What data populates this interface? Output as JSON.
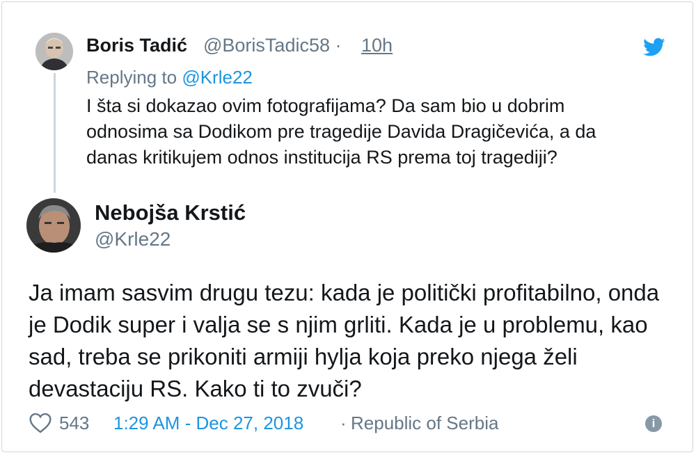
{
  "parent_tweet": {
    "name": "Boris Tadić",
    "handle": "@BorisTadic58",
    "separator": "·",
    "time": "10h",
    "replying_prefix": "Replying to",
    "replying_to": "@Krle22",
    "text": "I šta si dokazao ovim fotografijama? Da sam bio u dobrim odnosima sa Dodikom pre tragedije Davida Dragičevića, a da danas kritikujem odnos institucija RS prema toj tragediji?"
  },
  "main_tweet": {
    "name": "Nebojša Krstić",
    "handle": "@Krle22",
    "text": "Ja imam sasvim drugu tezu: kada je politički profitabilno, onda je Dodik super i valja se s njim grliti. Kada je u problemu, kao sad, treba se prikoniti armiji hylja koja preko njega želi devastaciju RS. Kako ti to zvuči?"
  },
  "footer": {
    "likes": "543",
    "timestamp": "1:29 AM - Dec 27, 2018",
    "separator": "·",
    "location": "Republic of Serbia",
    "info_glyph": "i"
  },
  "icons": {
    "logo": "twitter-bird-icon",
    "like": "heart-icon",
    "info": "info-icon"
  },
  "colors": {
    "link": "#1b95e0",
    "muted": "#657786",
    "text": "#14171a",
    "brand": "#1da1f2"
  }
}
